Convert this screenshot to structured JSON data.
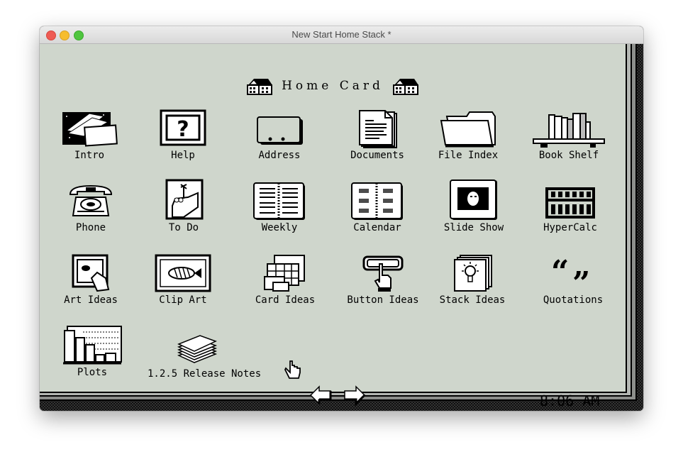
{
  "window": {
    "title": "New Start Home Stack *",
    "controls": [
      "close",
      "minimize",
      "zoom"
    ]
  },
  "card": {
    "title": "Home Card",
    "header_icon": "house-icon",
    "clock": "8:06 AM",
    "navigation": {
      "prev_icon": "left-arrow-icon",
      "next_icon": "right-arrow-icon"
    },
    "cursor_icon": "browse-hand-icon",
    "icons": [
      {
        "label": "Intro",
        "icon": "intro-cards-icon"
      },
      {
        "label": "Help",
        "icon": "help-question-icon"
      },
      {
        "label": "Address",
        "icon": "rolodex-card-icon"
      },
      {
        "label": "Documents",
        "icon": "document-pages-icon"
      },
      {
        "label": "File Index",
        "icon": "folder-icon"
      },
      {
        "label": "Book Shelf",
        "icon": "bookshelf-icon"
      },
      {
        "label": "Phone",
        "icon": "telephone-icon"
      },
      {
        "label": "To Do",
        "icon": "finger-string-icon"
      },
      {
        "label": "Weekly",
        "icon": "weekly-planner-icon"
      },
      {
        "label": "Calendar",
        "icon": "calendar-book-icon"
      },
      {
        "label": "Slide Show",
        "icon": "slide-portrait-icon"
      },
      {
        "label": "HyperCalc",
        "icon": "abacus-icon"
      },
      {
        "label": "Art Ideas",
        "icon": "art-frame-hand-icon"
      },
      {
        "label": "Clip Art",
        "icon": "fish-frame-icon"
      },
      {
        "label": "Card Ideas",
        "icon": "card-layouts-icon"
      },
      {
        "label": "Button Ideas",
        "icon": "button-press-icon"
      },
      {
        "label": "Stack Ideas",
        "icon": "lightbulb-stack-icon"
      },
      {
        "label": "Quotations",
        "icon": "quotation-marks-icon"
      },
      {
        "label": "Plots",
        "icon": "bar-chart-icon"
      },
      {
        "label": "1.2.5 Release Notes",
        "icon": "paper-stack-icon"
      }
    ]
  }
}
